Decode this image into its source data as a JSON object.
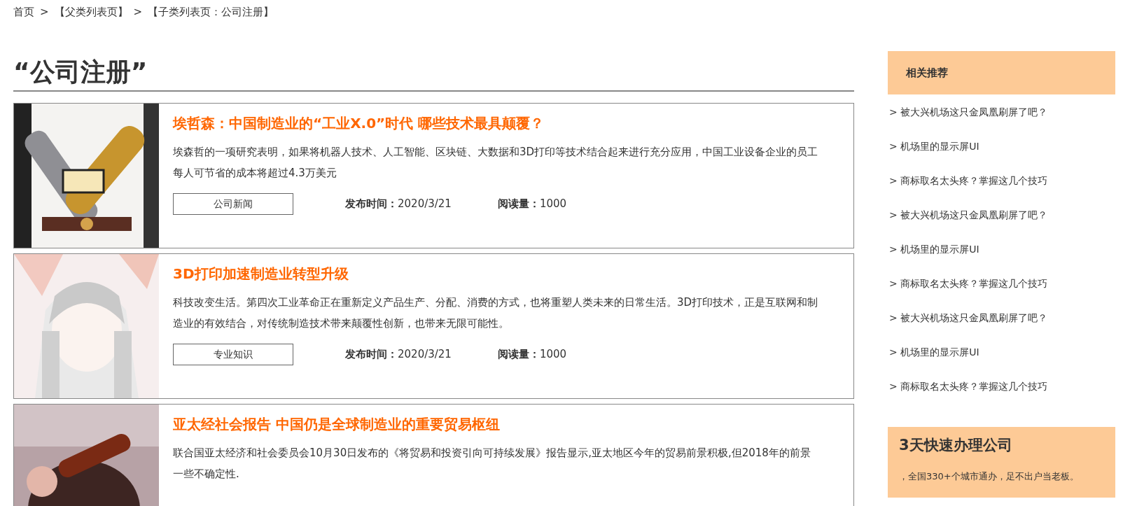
{
  "breadcrumb": [
    "首页",
    ">",
    "【父类列表页】",
    ">",
    "【子类列表页：公司注册】"
  ],
  "page_title": "“公司注册”",
  "articles": [
    {
      "title": "埃哲森：中国制造业的“工业X.0”时代 哪些技术最具颠覆？",
      "summary": "埃森哲的一项研究表明，如果将机器人技术、人工智能、区块链、大数据和3D打印等技术结合起来进行充分应用，中国工业设备企业的员工每人可节省的成本将超过4.3万美元",
      "tag": "公司新闻",
      "date_label": "发布时间：",
      "date": "2020/3/21",
      "views_label": "阅读量：",
      "views": "1000"
    },
    {
      "title": "3D打印加速制造业转型升级",
      "summary": "科技改变生活。第四次工业革命正在重新定义产品生产、分配、消费的方式，也将重塑人类未来的日常生活。3D打印技术，正是互联网和制造业的有效结合，对传统制造技术带来颠覆性创新，也带来无限可能性。",
      "tag": "专业知识",
      "date_label": "发布时间：",
      "date": "2020/3/21",
      "views_label": "阅读量：",
      "views": "1000"
    },
    {
      "title": "亚太经社会报告 中国仍是全球制造业的重要贸易枢纽",
      "summary": "联合国亚太经济和社会委员会10月30日发布的《将贸易和投资引向可持续发展》报告显示,亚太地区今年的贸易前景积极,但2018年的前景一些不确定性."
    }
  ],
  "sidebar": {
    "related": {
      "heading": "相关推荐",
      "items": [
        "> 被大兴机场这只金凤凰刷屏了吧？",
        "> 机场里的显示屏UI",
        "> 商标取名太头疼？掌握这几个技巧",
        "> 被大兴机场这只金凤凰刷屏了吧？",
        "> 机场里的显示屏UI",
        "> 商标取名太头疼？掌握这几个技巧",
        "> 被大兴机场这只金凤凰刷屏了吧？",
        "> 机场里的显示屏UI",
        "> 商标取名太头疼？掌握这几个技巧"
      ]
    },
    "promo": {
      "title": "3天快速办理公司",
      "text": "，全国330+个城市通办，足不出户当老板。"
    }
  }
}
